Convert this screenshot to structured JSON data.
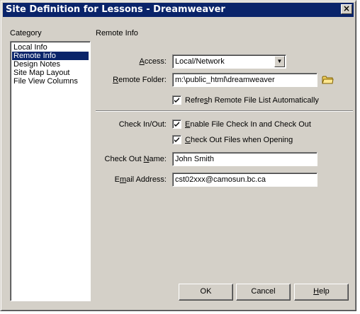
{
  "window": {
    "title": "Site Definition for Lessons - Dreamweaver",
    "close_glyph": "×"
  },
  "category": {
    "heading": "Category",
    "items": [
      {
        "label": "Local Info",
        "selected": false
      },
      {
        "label": "Remote Info",
        "selected": true
      },
      {
        "label": "Design Notes",
        "selected": false
      },
      {
        "label": "Site Map Layout",
        "selected": false
      },
      {
        "label": "File View Columns",
        "selected": false
      }
    ]
  },
  "panel": {
    "heading": "Remote Info",
    "access": {
      "label_pre": "",
      "label_u": "A",
      "label_post": "ccess:",
      "value": "Local/Network"
    },
    "remote_folder": {
      "label_pre": "",
      "label_u": "R",
      "label_post": "emote Folder:",
      "value": "m:\\public_html\\dreamweaver",
      "icon": "folder-icon"
    },
    "refresh": {
      "label_pre": "Refre",
      "label_u": "s",
      "label_post": "h Remote File List Automatically",
      "checked": true
    },
    "check_in_out": {
      "label": "Check In/Out:",
      "enable": {
        "label_pre": "",
        "label_u": "E",
        "label_post": "nable File Check In and Check Out",
        "checked": true
      },
      "check_out_opening": {
        "label_pre": "",
        "label_u": "C",
        "label_post": "heck Out Files when Opening",
        "checked": true
      }
    },
    "check_out_name": {
      "label_pre": "Check Out ",
      "label_u": "N",
      "label_post": "ame:",
      "value": "John Smith"
    },
    "email": {
      "label_pre": "E",
      "label_u": "m",
      "label_post": "ail Address:",
      "value": "cst02xxx@camosun.bc.ca"
    }
  },
  "buttons": {
    "ok": "OK",
    "cancel": "Cancel",
    "help_pre": "",
    "help_u": "H",
    "help_post": "elp"
  },
  "colors": {
    "titlebar": "#0a246a",
    "face": "#d4d0c8",
    "selection": "#0a246a"
  }
}
